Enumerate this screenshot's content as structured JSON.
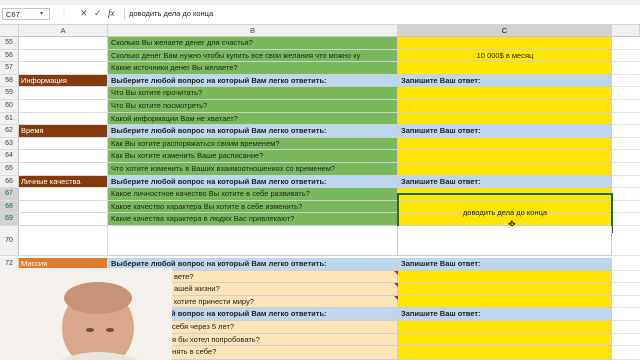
{
  "formula_bar": {
    "name_box": "C67",
    "name_box_arrow": "▾",
    "separator": "⋮",
    "cancel_icon": "✕",
    "enter_icon": "✓",
    "fx_label": "fx",
    "formula": "доводить дела  до конца"
  },
  "column_headers": {
    "corner": "",
    "a": "A",
    "b": "B",
    "c": "C",
    "d": ""
  },
  "rows": [
    {
      "num": "55",
      "a": "",
      "b": "Сколько Вы желаете денег для счастья?",
      "c": ""
    },
    {
      "num": "56",
      "a": "",
      "b": "Сколько денег Вам нужно чтобы купить все свои желания что можно ку",
      "c": ""
    },
    {
      "num": "57",
      "a": "",
      "b": "Какие источники денег Вы желаете?",
      "c": ""
    },
    {
      "num": "58",
      "a": "Информация",
      "b": "Выберите любой вопрос на который Вам легко ответить:",
      "c": "Запишите Ваш ответ:"
    },
    {
      "num": "59",
      "a": "",
      "b": "Что Вы хотите прочитать?",
      "c": ""
    },
    {
      "num": "60",
      "a": "",
      "b": "Что  Вы хотите посмотреть?",
      "c": ""
    },
    {
      "num": "61",
      "a": "",
      "b": "Какой информации Вам не хватает?",
      "c": ""
    },
    {
      "num": "62",
      "a": "Время",
      "b": "Выберите любой вопрос на который Вам легко ответить:",
      "c": "Запишите Ваш ответ:"
    },
    {
      "num": "63",
      "a": "",
      "b": "Как Вы хотите распоряжаться своим временем?",
      "c": ""
    },
    {
      "num": "64",
      "a": "",
      "b": "Как Вы хотите изменить Ваше расписание?",
      "c": ""
    },
    {
      "num": "65",
      "a": "",
      "b": "Что хотите изменить в Ваших взаимоотношениях со временем?",
      "c": ""
    },
    {
      "num": "66",
      "a": "Личные качества",
      "b": "Выберите любой вопрос на который Вам легко ответить:",
      "c": "Запишите Ваш ответ:"
    },
    {
      "num": "67",
      "a": "",
      "b": "Какое личностное качество Вы хотите в себе развивать?",
      "c": ""
    },
    {
      "num": "68",
      "a": "",
      "b": "Какое качество характера Вы хотите в себе изменить?",
      "c": ""
    },
    {
      "num": "69",
      "a": "",
      "b": "Какие качества характера в людях Вас привлекают?",
      "c": ""
    },
    {
      "num": "70",
      "a": "",
      "b": "",
      "c": ""
    },
    {
      "num": "72",
      "a": "Миссия",
      "b": "Выберите любой вопрос на который Вам легко ответить:",
      "c": "Запишите Ваш ответ:"
    },
    {
      "num": "73",
      "a": "",
      "b": "вете?",
      "c": ""
    },
    {
      "num": "74",
      "a": "",
      "b": "ашей жизни?",
      "c": ""
    },
    {
      "num": "75",
      "a": "",
      "b": "ы хотите принести миру?",
      "c": ""
    },
    {
      "num": "76",
      "a": "",
      "b": "Выберите любой вопрос на который Вам легко ответить:",
      "c": "Запишите Ваш ответ:"
    },
    {
      "num": "77",
      "a": "",
      "b": "себя через 5 лет?",
      "c": ""
    },
    {
      "num": "78",
      "a": "",
      "b": "я бы хотел попробовать?",
      "c": ""
    },
    {
      "num": "79",
      "a": "",
      "b": "енять в себе?",
      "c": ""
    }
  ],
  "merged_answers": {
    "money": "10 000$ в  месяц",
    "qualities": "доводить дела  до конца"
  },
  "cursor_icon": "✥"
}
